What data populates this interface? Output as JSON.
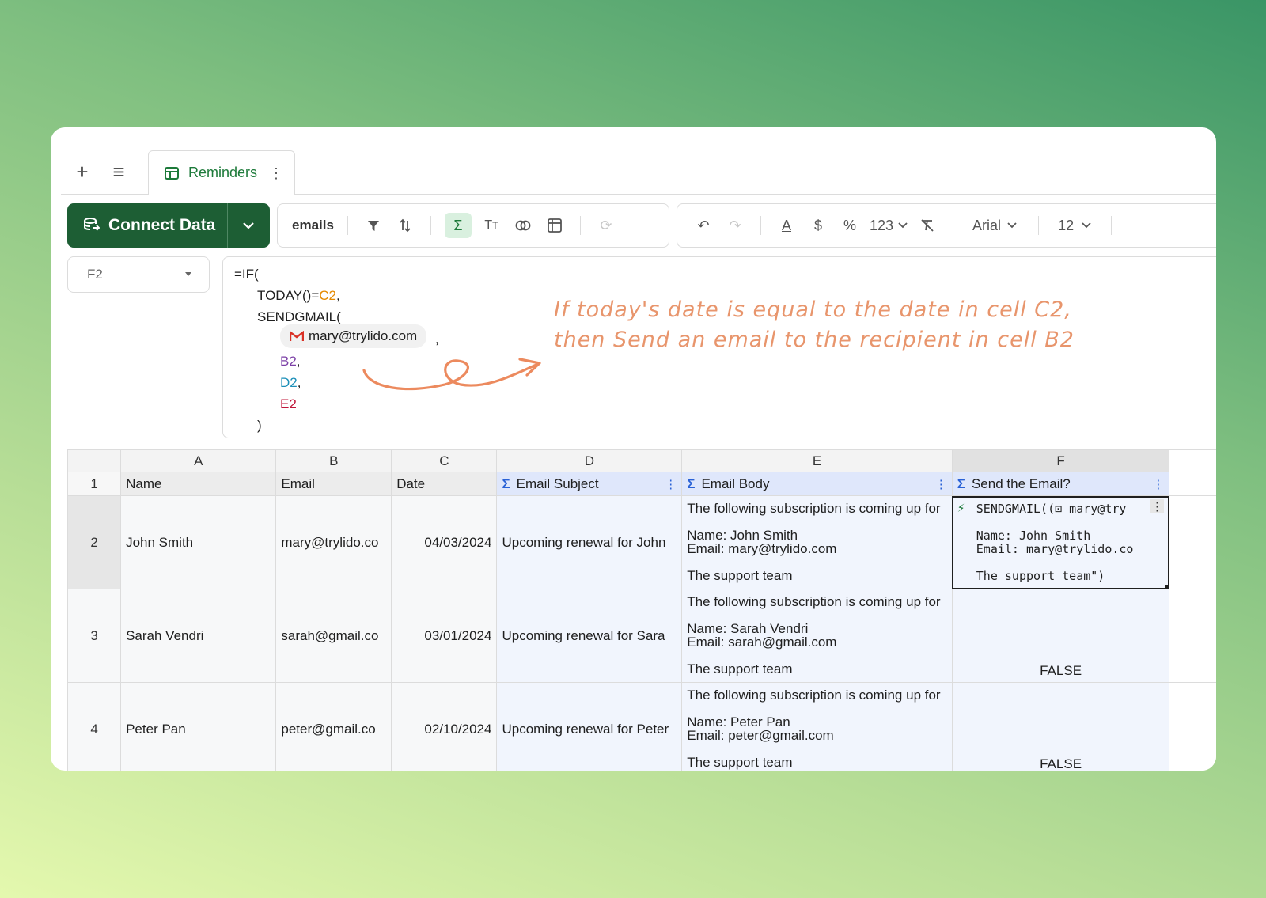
{
  "tabs": {
    "add_icon": "+",
    "menu_icon": "≡",
    "active": "Reminders"
  },
  "toolbar": {
    "connect_label": "Connect Data",
    "filter_value": "emails",
    "number_format": "123",
    "font": "Arial",
    "font_size": "12"
  },
  "name_box": "F2",
  "formula": {
    "l1": "=IF(",
    "l2a": "TODAY()=",
    "l2b": "C2",
    "l2c": ",",
    "l3": "SENDGMAIL(",
    "chip": "mary@trylido.com",
    "chip_comma": ",",
    "l5": "B2",
    "l6": "D2",
    "l7": "E2",
    "comma": ",",
    "l8": ")"
  },
  "annotation": {
    "line1": "If today's date is equal to the date in cell C2,",
    "line2": "then Send an email to the recipient in cell B2"
  },
  "grid": {
    "columns": [
      "A",
      "B",
      "C",
      "D",
      "E",
      "F"
    ],
    "header_row_num": "1",
    "headers": [
      "Name",
      "Email",
      "Date",
      "Email Subject",
      "Email Body",
      "Send the Email?"
    ],
    "rows": [
      {
        "num": "2",
        "name": "John Smith",
        "email": "mary@trylido.co",
        "date": "04/03/2024",
        "subject": "Upcoming renewal for John",
        "body1": "The following subscription is coming up for",
        "body2": "Name: John Smith",
        "body3": "Email: mary@trylido.com",
        "body4": "The support team",
        "f1": "SENDGMAIL((⊡ mary@try",
        "f2": "Name: John Smith",
        "f3": "Email: mary@trylido.co",
        "f4": "The support team\")"
      },
      {
        "num": "3",
        "name": "Sarah Vendri",
        "email": "sarah@gmail.co",
        "date": "03/01/2024",
        "subject": "Upcoming renewal for Sara",
        "body1": "The following subscription is coming up for",
        "body2": "Name: Sarah Vendri",
        "body3": "Email: sarah@gmail.com",
        "body4": "The support team",
        "result": "FALSE"
      },
      {
        "num": "4",
        "name": "Peter Pan",
        "email": "peter@gmail.co",
        "date": "02/10/2024",
        "subject": "Upcoming renewal for Peter",
        "body1": "The following subscription is coming up for",
        "body2": "Name: Peter Pan",
        "body3": "Email: peter@gmail.com",
        "body4": "The support team",
        "result": "FALSE"
      }
    ]
  },
  "colors": {
    "brand_green": "#1d5e34",
    "annotation": "#e8956c",
    "accent_blue": "#2a62d6"
  }
}
